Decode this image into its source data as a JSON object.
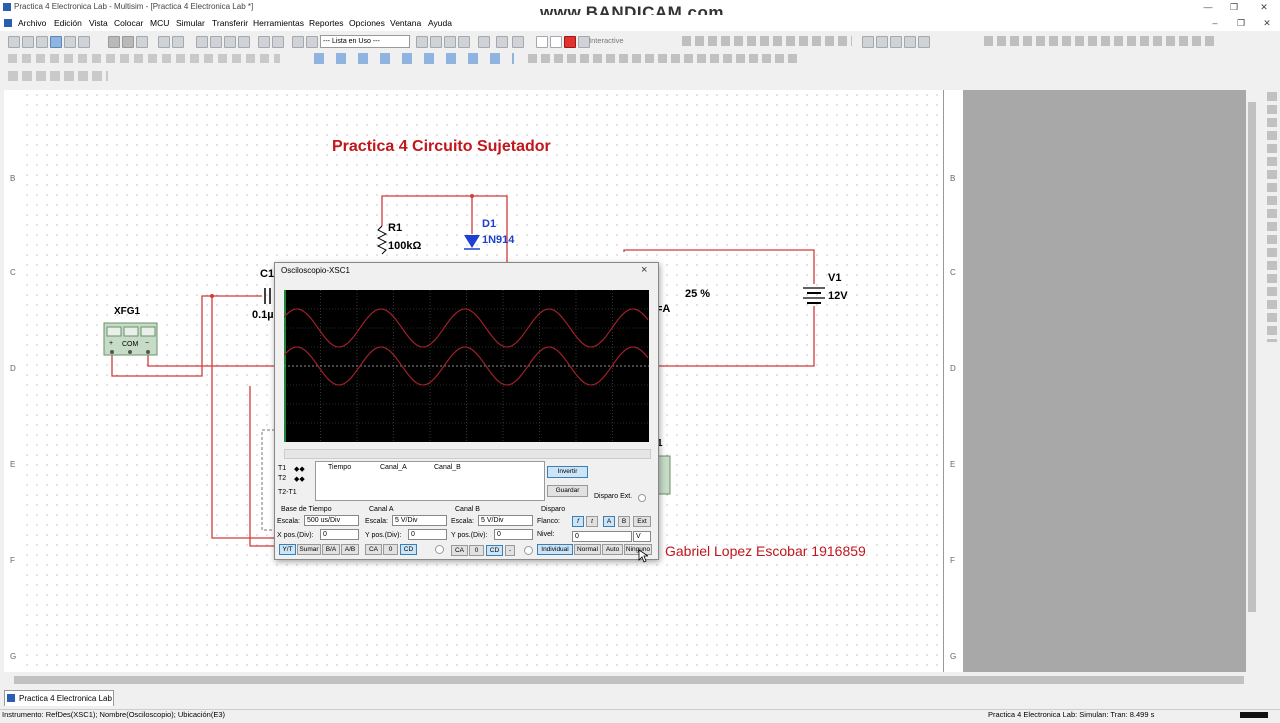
{
  "window": {
    "title": "Practica 4 Electronica Lab - Multisim - [Practica 4 Electronica Lab *]",
    "watermark": "www.BANDICAM.com"
  },
  "menu": [
    "Archivo",
    "Edición",
    "Vista",
    "Colocar",
    "MCU",
    "Simular",
    "Transferir",
    "Herramientas",
    "Reportes",
    "Opciones",
    "Ventana",
    "Ayuda"
  ],
  "toolbar": {
    "in_use_list": "--- Lista en Uso ---",
    "interactive_label": "Interactive"
  },
  "rulers": {
    "left": [
      "B",
      "C",
      "D",
      "E",
      "F",
      "G"
    ],
    "right": [
      "B",
      "C",
      "D",
      "E",
      "F",
      "G"
    ]
  },
  "circuit": {
    "title": "Practica 4 Circuito Sujetador",
    "r1_name": "R1",
    "r1_value": "100kΩ",
    "d1_name": "D1",
    "d1_value": "1N914",
    "c1_name": "C1",
    "c1_value": "0.1µ",
    "v1_name": "V1",
    "v1_value": "12V",
    "key_label": "=A",
    "percent_label": "25 %",
    "xfg1_label": "XFG1",
    "xfg1_com": "COM",
    "xfg1_plus": "+",
    "xfg1_minus": "−",
    "scope_tag": "1",
    "author": "Gabriel Lopez Escobar 1916859"
  },
  "oscilloscope": {
    "title": "Osciloscopio-XSC1",
    "close": "×",
    "cursor_rows": [
      "T1",
      "T2",
      "T2-T1"
    ],
    "columns": [
      "Tiempo",
      "Canal_A",
      "Canal_B"
    ],
    "invert_label": "Invertir",
    "save_label": "Guardar",
    "ext_trigger_label": "Disparo Ext.",
    "timebase": {
      "group": "Base de Tiempo",
      "scale_label": "Escala:",
      "scale": "500 us/Div",
      "xpos_label": "X pos.(Div):",
      "xpos": "0",
      "buttons": [
        "Y/T",
        "Sumar",
        "B/A",
        "A/B"
      ]
    },
    "channel_a": {
      "group": "Canal A",
      "scale_label": "Escala:",
      "scale": "5  V/Div",
      "ypos_label": "Y pos.(Div):",
      "ypos": "0",
      "buttons": [
        "CA",
        "0",
        "CD"
      ]
    },
    "channel_b": {
      "group": "Canal B",
      "scale_label": "Escala:",
      "scale": "5  V/Div",
      "ypos_label": "Y pos.(Div):",
      "ypos": "0",
      "buttons": [
        "CA",
        "0",
        "CD",
        "-"
      ]
    },
    "trigger": {
      "group": "Disparo",
      "edge_label": "Flanco:",
      "edge_buttons": [
        "f",
        "t",
        "A",
        "B",
        "Ext"
      ],
      "level_label": "Nivel:",
      "level": "0",
      "level_unit": "V",
      "mode_buttons": [
        "Individual",
        "Normal",
        "Auto",
        "Ninguno"
      ]
    }
  },
  "tabs": [
    "Practica 4 Electronica Lab *"
  ],
  "status": {
    "left": "Instrumento: RefDes(XSC1); Nombre(Osciloscopio); Ubicación(E3)",
    "right": "Practica 4 Electronica Lab: Simulan: Tran: 8.499 s"
  },
  "colors": {
    "wire": "#d23a3a",
    "diode": "#1e3fd0",
    "title_text": "#c0161c",
    "trace": "#a0202a",
    "scope_bg": "#000000"
  }
}
